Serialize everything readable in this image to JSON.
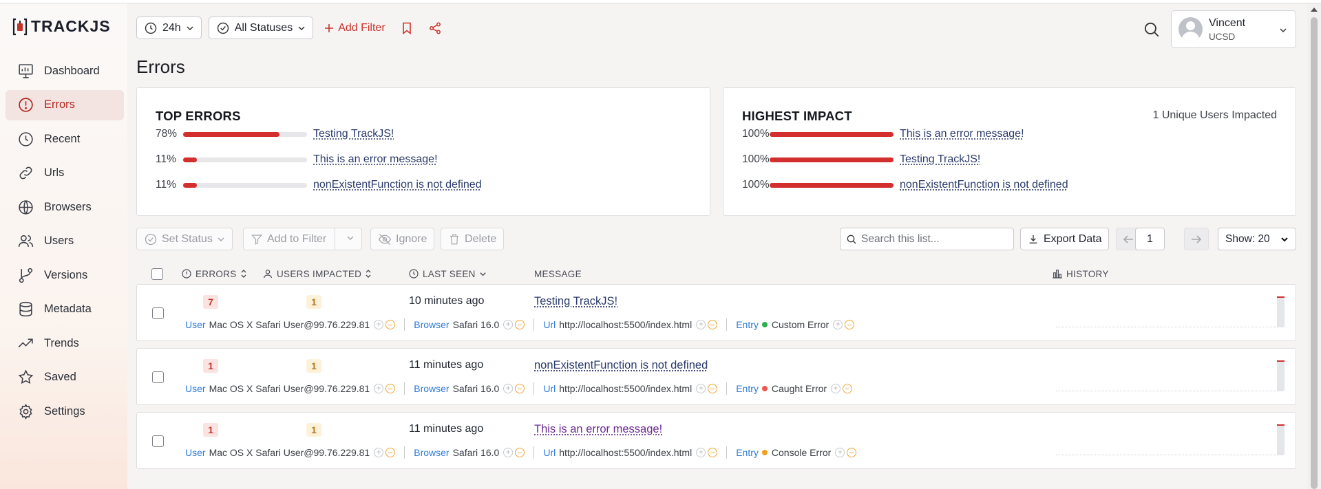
{
  "brand": {
    "logo_text": "TRACKJS"
  },
  "sidebar": {
    "items": [
      {
        "label": "Dashboard",
        "icon": "dashboard-icon"
      },
      {
        "label": "Errors",
        "icon": "error-circle-icon",
        "active": true
      },
      {
        "label": "Recent",
        "icon": "clock-icon"
      },
      {
        "label": "Urls",
        "icon": "link-icon"
      },
      {
        "label": "Browsers",
        "icon": "globe-icon"
      },
      {
        "label": "Users",
        "icon": "users-icon"
      },
      {
        "label": "Versions",
        "icon": "branch-icon"
      },
      {
        "label": "Metadata",
        "icon": "database-icon"
      },
      {
        "label": "Trends",
        "icon": "trend-icon"
      },
      {
        "label": "Saved",
        "icon": "star-icon"
      },
      {
        "label": "Settings",
        "icon": "gear-icon"
      }
    ]
  },
  "toolbar": {
    "time_range": "24h",
    "status": "All Statuses",
    "add_filter": "Add Filter"
  },
  "user": {
    "name": "Vincent",
    "org": "UCSD"
  },
  "page": {
    "title": "Errors"
  },
  "top_errors": {
    "title": "TOP ERRORS",
    "items": [
      {
        "pct": "78%",
        "value": 78,
        "label": "Testing TrackJS!"
      },
      {
        "pct": "11%",
        "value": 11,
        "label": "This is an error message!"
      },
      {
        "pct": "11%",
        "value": 11,
        "label": "nonExistentFunction is not defined"
      }
    ]
  },
  "highest_impact": {
    "title": "HIGHEST IMPACT",
    "note": "1 Unique Users Impacted",
    "items": [
      {
        "pct": "100%",
        "value": 100,
        "label": "This is an error message!"
      },
      {
        "pct": "100%",
        "value": 100,
        "label": "Testing TrackJS!"
      },
      {
        "pct": "100%",
        "value": 100,
        "label": "nonExistentFunction is not defined"
      }
    ]
  },
  "actions": {
    "set_status": "Set Status",
    "add_to_filter": "Add to Filter",
    "ignore": "Ignore",
    "delete": "Delete",
    "search_placeholder": "Search this list...",
    "export": "Export Data",
    "page": "1",
    "show": "Show: 20"
  },
  "table": {
    "headers": {
      "errors": "ERRORS",
      "users": "USERS IMPACTED",
      "last_seen": "LAST SEEN",
      "message": "MESSAGE",
      "history": "HISTORY"
    },
    "meta_labels": {
      "user": "User",
      "browser": "Browser",
      "url": "Url",
      "entry": "Entry"
    },
    "rows": [
      {
        "errors": "7",
        "users": "1",
        "last_seen": "10 minutes ago",
        "message": "Testing TrackJS!",
        "user": "Mac OS X Safari User@99.76.229.81",
        "browser": "Safari 16.0",
        "url": "http://localhost:5500/index.html",
        "entry": "Custom Error",
        "entry_color": "#2bb04a",
        "visited": false
      },
      {
        "errors": "1",
        "users": "1",
        "last_seen": "11 minutes ago",
        "message": "nonExistentFunction is not defined",
        "user": "Mac OS X Safari User@99.76.229.81",
        "browser": "Safari 16.0",
        "url": "http://localhost:5500/index.html",
        "entry": "Caught Error",
        "entry_color": "#e85a4f",
        "visited": false
      },
      {
        "errors": "1",
        "users": "1",
        "last_seen": "11 minutes ago",
        "message": "This is an error message!",
        "user": "Mac OS X Safari User@99.76.229.81",
        "browser": "Safari 16.0",
        "url": "http://localhost:5500/index.html",
        "entry": "Console Error",
        "entry_color": "#f0a020",
        "visited": true
      }
    ]
  },
  "colors": {
    "accent": "#c8322a",
    "bar_fill": "#d32f2f",
    "link_blue": "#2f7bd6"
  }
}
